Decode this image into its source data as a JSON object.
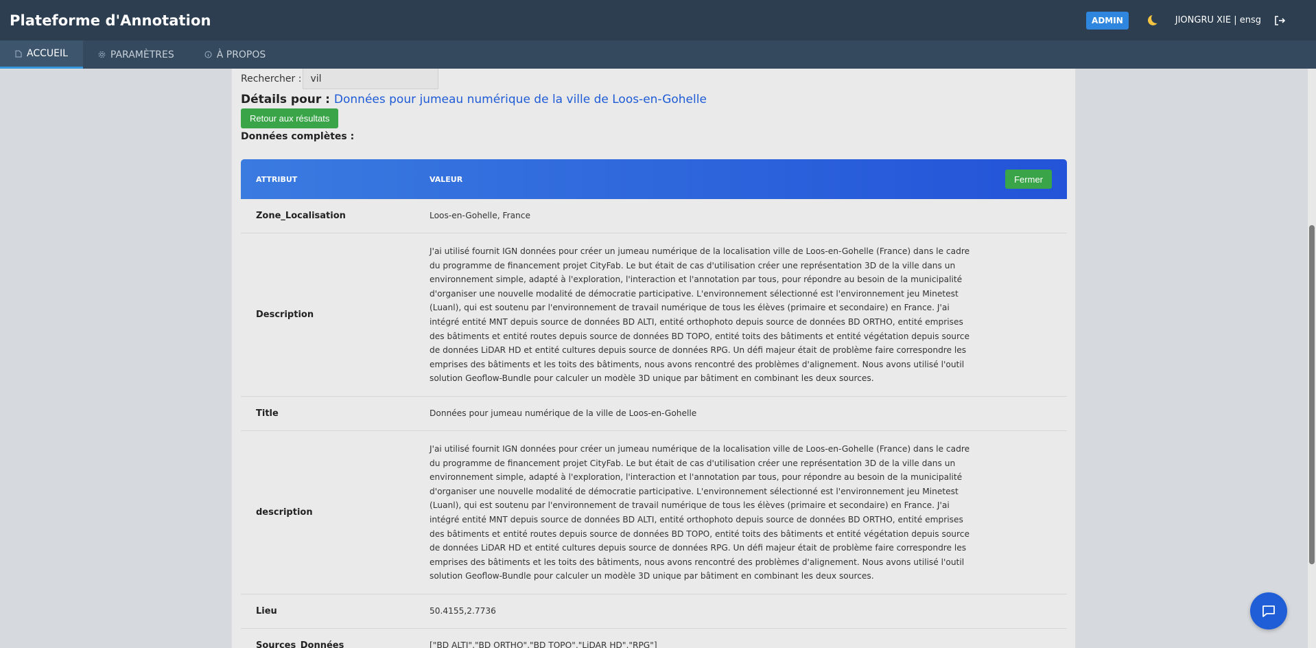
{
  "header": {
    "app_title": "Plateforme d'Annotation",
    "admin_badge": "ADMIN",
    "user": "JIONGRU XIE | ensg"
  },
  "nav": {
    "tabs": [
      {
        "label": "ACCUEIL",
        "icon": "document-icon",
        "active": true
      },
      {
        "label": "PARAMÈTRES",
        "icon": "gear-icon",
        "active": false
      },
      {
        "label": "À PROPOS",
        "icon": "info-icon",
        "active": false
      }
    ]
  },
  "search": {
    "label": "Rechercher :",
    "value": "vil"
  },
  "details": {
    "prefix": "Détails pour :",
    "title": "Données pour jumeau numérique de la ville de Loos-en-Gohelle",
    "back_button": "Retour aux résultats",
    "full_data_label": "Données complètes :"
  },
  "table": {
    "header": {
      "attribute": "ATTRIBUT",
      "value": "VALEUR",
      "close_button": "Fermer"
    },
    "rows": [
      {
        "attribute": "Zone_Localisation",
        "value": "Loos-en-Gohelle, France"
      },
      {
        "attribute": "Description",
        "value": "J'ai utilisé fournit IGN données pour créer un jumeau numérique de la localisation ville de Loos-en-Gohelle (France) dans le cadre du programme de financement projet CityFab. Le but était de cas d'utilisation créer une représentation 3D de la ville dans un environnement simple, adapté à l'exploration, l'interaction et l'annotation par tous, pour répondre au besoin de la municipalité d'organiser une nouvelle modalité de démocratie participative. L'environnement sélectionné est l'environnement jeu Minetest (Luanl), qui est soutenu par l'environnement de travail numérique de tous les élèves (primaire et secondaire) en France. J'ai intégré entité MNT depuis source de données BD ALTI, entité orthophoto depuis source de données BD ORTHO, entité emprises des bâtiments et entité routes depuis source de données BD TOPO, entité toits des bâtiments et entité végétation depuis source de données LiDAR HD et entité cultures depuis source de données RPG. Un défi majeur était de problème faire correspondre les emprises des bâtiments et les toits des bâtiments, nous avons rencontré des problèmes d'alignement. Nous avons utilisé l'outil solution Geoflow-Bundle pour calculer un modèle 3D unique par bâtiment en combinant les deux sources."
      },
      {
        "attribute": "Title",
        "value": "Données pour jumeau numérique de la ville de Loos-en-Gohelle"
      },
      {
        "attribute": "description",
        "value": "J'ai utilisé fournit IGN données pour créer un jumeau numérique de la localisation ville de Loos-en-Gohelle (France) dans le cadre du programme de financement projet CityFab. Le but était de cas d'utilisation créer une représentation 3D de la ville dans un environnement simple, adapté à l'exploration, l'interaction et l'annotation par tous, pour répondre au besoin de la municipalité d'organiser une nouvelle modalité de démocratie participative. L'environnement sélectionné est l'environnement jeu Minetest (Luanl), qui est soutenu par l'environnement de travail numérique de tous les élèves (primaire et secondaire) en France. J'ai intégré entité MNT depuis source de données BD ALTI, entité orthophoto depuis source de données BD ORTHO, entité emprises des bâtiments et entité routes depuis source de données BD TOPO, entité toits des bâtiments et entité végétation depuis source de données LiDAR HD et entité cultures depuis source de données RPG. Un défi majeur était de problème faire correspondre les emprises des bâtiments et les toits des bâtiments, nous avons rencontré des problèmes d'alignement. Nous avons utilisé l'outil solution Geoflow-Bundle pour calculer un modèle 3D unique par bâtiment en combinant les deux sources."
      },
      {
        "attribute": "Lieu",
        "value": "50.4155,2.7736"
      },
      {
        "attribute": "Sources_Données",
        "value": "[\"BD ALTI\",\"BD ORTHO\",\"BD TOPO\",\"LiDAR HD\",\"RPG\"]"
      }
    ]
  },
  "colors": {
    "topbar": "#2c3e50",
    "navbar": "#34495e",
    "accent_blue": "#2353d8",
    "button_green": "#3aa449",
    "link_blue": "#1e5bd6"
  }
}
